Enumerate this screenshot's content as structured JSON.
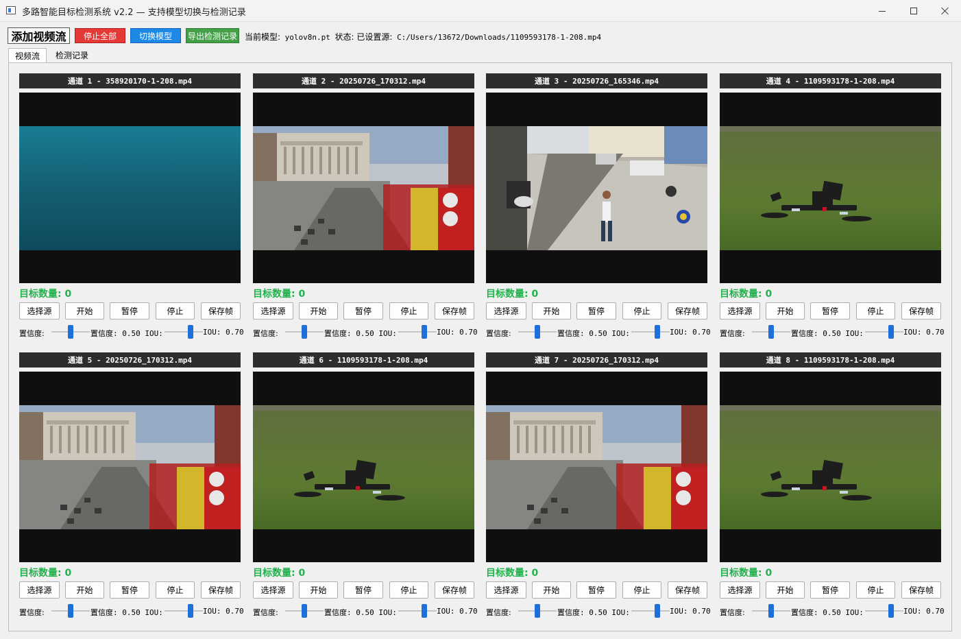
{
  "window": {
    "title": "多路智能目标检测系统 v2.2 — 支持模型切换与检测记录"
  },
  "toolbar": {
    "add_label": "添加视频流",
    "stop_all_label": "停止全部",
    "switch_model_label": "切换模型",
    "export_label": "导出检测记录",
    "model_prefix": "当前模型:",
    "model_value": "yolov8n.pt",
    "status_prefix": "状态: 已设置源:",
    "status_value": "C:/Users/13672/Downloads/1109593178-1-208.mp4"
  },
  "tabs": [
    {
      "label": "视频流",
      "active": true
    },
    {
      "label": "检测记录",
      "active": false
    }
  ],
  "buttons": {
    "select_source": "选择源",
    "start": "开始",
    "pause": "暂停",
    "stop": "停止",
    "save_frame": "保存帧"
  },
  "controls": {
    "conf_label": "置信度:",
    "conf_value": "置信度: 0.50 IOU:",
    "iou_value": "IOU: 0.70",
    "conf_level": 0.5,
    "iou_level": 0.7
  },
  "channels": [
    {
      "title": "通道 1 - 358920170-1-208.mp4",
      "count": "目标数量: 0",
      "scene": "teal"
    },
    {
      "title": "通道 2 - 20250726_170312.mp4",
      "count": "目标数量: 0",
      "scene": "rome"
    },
    {
      "title": "通道 3 - 20250726_165346.mp4",
      "count": "目标数量: 0",
      "scene": "street"
    },
    {
      "title": "通道 4 - 1109593178-1-208.mp4",
      "count": "目标数量: 0",
      "scene": "drone"
    },
    {
      "title": "通道 5 - 20250726_170312.mp4",
      "count": "目标数量: 0",
      "scene": "rome"
    },
    {
      "title": "通道 6 - 1109593178-1-208.mp4",
      "count": "目标数量: 0",
      "scene": "drone"
    },
    {
      "title": "通道 7 - 20250726_170312.mp4",
      "count": "目标数量: 0",
      "scene": "rome"
    },
    {
      "title": "通道 8 - 1109593178-1-208.mp4",
      "count": "目标数量: 0",
      "scene": "drone"
    }
  ],
  "colors": {
    "stop_all": "#e53935",
    "switch_model": "#1e88e5",
    "export": "#43a047",
    "count_text": "#22b14c",
    "slider_thumb": "#1e6fd9"
  }
}
